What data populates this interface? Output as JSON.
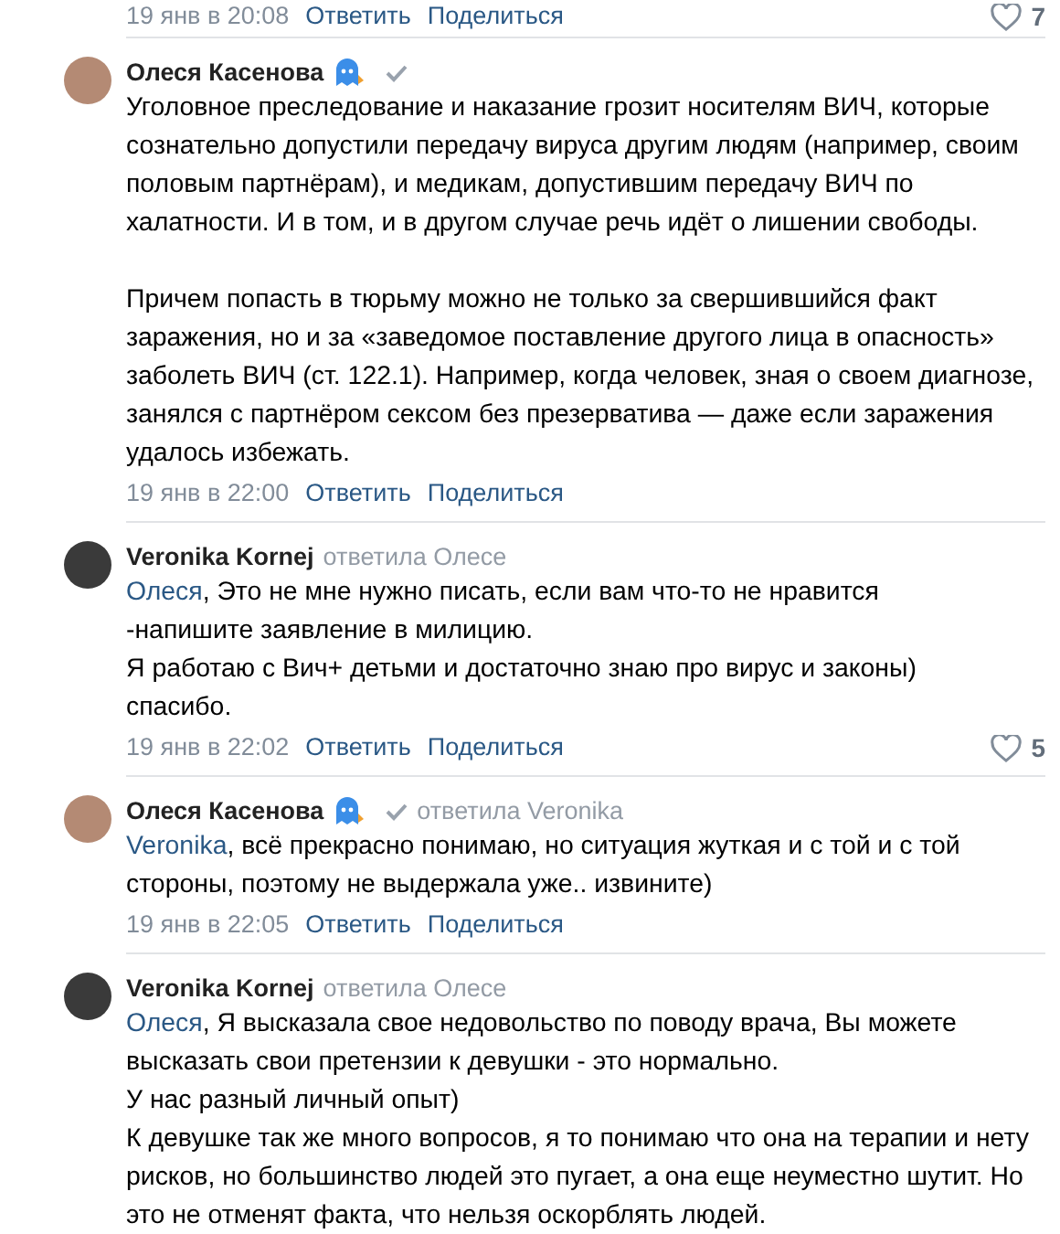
{
  "top_meta": {
    "date": "19 янв в 20:08",
    "actions": [
      "Ответить",
      "Поделиться"
    ],
    "likes": "7"
  },
  "comments": [
    {
      "author": "Олеся Касенова",
      "status_emoji": true,
      "verified": true,
      "text": "Уголовное преследование и наказание грозит носителям ВИЧ, которые сознательно допустили передачу вируса другим людям (например, своим половым партнёрам), и медикам, допустившим передачу ВИЧ по халатности. И в том, и в другом случае речь идёт о лишении свободы.\n\nПричем попасть в тюрьму можно не только за свершившийся факт заражения, но и за «заведомое поставление другого лица в опасность» заболеть ВИЧ (ст. 122.1). Например, когда человек, зная о своем диагнозе, занялся с партнёром сексом без презерватива — даже если заражения удалось избежать.",
      "date": "19 янв в 22:00",
      "actions": [
        "Ответить",
        "Поделиться"
      ]
    },
    {
      "author": "Veronika Kornej",
      "status_emoji": false,
      "verified": false,
      "reply_to": "ответила Олесе",
      "mention": "Олеся",
      "text": ", Это не мне нужно писать, если вам что-то не нравится\n-напишите заявление в милицию.\nЯ работаю с Вич+ детьми и достаточно знаю про вирус и законы)\nспасибо.",
      "date": "19 янв в 22:02",
      "actions": [
        "Ответить",
        "Поделиться"
      ],
      "likes": "5"
    },
    {
      "author": "Олеся Касенова",
      "status_emoji": true,
      "verified": true,
      "reply_to": "ответила Veronika",
      "mention": "Veronika",
      "text": ", всё прекрасно понимаю, но ситуация жуткая и с той и с той стороны, поэтому не выдержала уже.. извините)",
      "date": "19 янв в 22:05",
      "actions": [
        "Ответить",
        "Поделиться"
      ]
    },
    {
      "author": "Veronika Kornej",
      "status_emoji": false,
      "verified": false,
      "reply_to": "ответила Олесе",
      "mention": "Олеся",
      "text": ", Я высказала свое недовольство по поводу врача, Вы можете\nвысказать свои претензии к девушки - это нормально.\nУ нас разный личный опыт)\nК девушке так же много вопросов, я то понимаю что она на терапии и нету рисков, но большинство людей это пугает, а она еще неуместно шутит. Но это не отменят факта, что нельзя оскорблять людей."
    }
  ]
}
